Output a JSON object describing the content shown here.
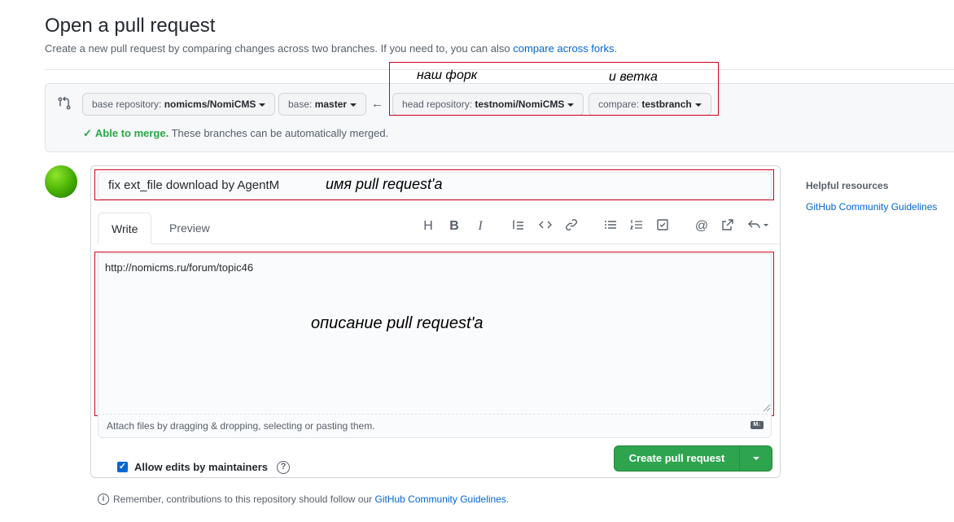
{
  "page": {
    "title": "Open a pull request",
    "subtitle": "Create a new pull request by comparing changes across two branches. If you need to, you can also ",
    "subtitle_link": "compare across forks."
  },
  "compare": {
    "base_repo_label": "base repository: ",
    "base_repo_value": "nomicms/NomiCMS",
    "base_label": "base: ",
    "base_value": "master",
    "head_repo_label": "head repository: ",
    "head_repo_value": "testnomi/NomiCMS",
    "compare_label": "compare: ",
    "compare_value": "testbranch",
    "merge_ok": "Able to merge.",
    "merge_text": " These branches can be automatically merged."
  },
  "annotations": {
    "fork": "наш форк",
    "branch": "и ветка",
    "pr_name": "имя pull request'a",
    "pr_desc": "описание pull request'a"
  },
  "editor": {
    "title_value": "fix ext_file download by AgentM",
    "tabs": [
      {
        "label": "Write"
      },
      {
        "label": "Preview"
      }
    ],
    "body_value": "http://nomicms.ru/forum/topic46",
    "attach_text": "Attach files by dragging & dropping, selecting or pasting them.",
    "markdown_badge": "M↓",
    "toolbar": {
      "heading": "H",
      "bold": "B",
      "italic": "I",
      "quote": "❝",
      "code": "<>",
      "link": "🔗",
      "ul": "☰",
      "ol": "≡",
      "task": "☑",
      "mention": "@",
      "reference": "↗",
      "reply": "↶"
    }
  },
  "actions": {
    "allow_edits": "Allow edits by maintainers",
    "allow_checked": true,
    "create_button": "Create pull request"
  },
  "footer": {
    "note": "Remember, contributions to this repository should follow our ",
    "note_link": "GitHub Community Guidelines",
    "note_end": "."
  },
  "sidebar": {
    "helpful_title": "Helpful resources",
    "helpful_link": "GitHub Community Guidelines"
  },
  "colors": {
    "accent_red": "#d0021b",
    "primary_green": "#2ea44f",
    "link_blue": "#0366d6"
  }
}
